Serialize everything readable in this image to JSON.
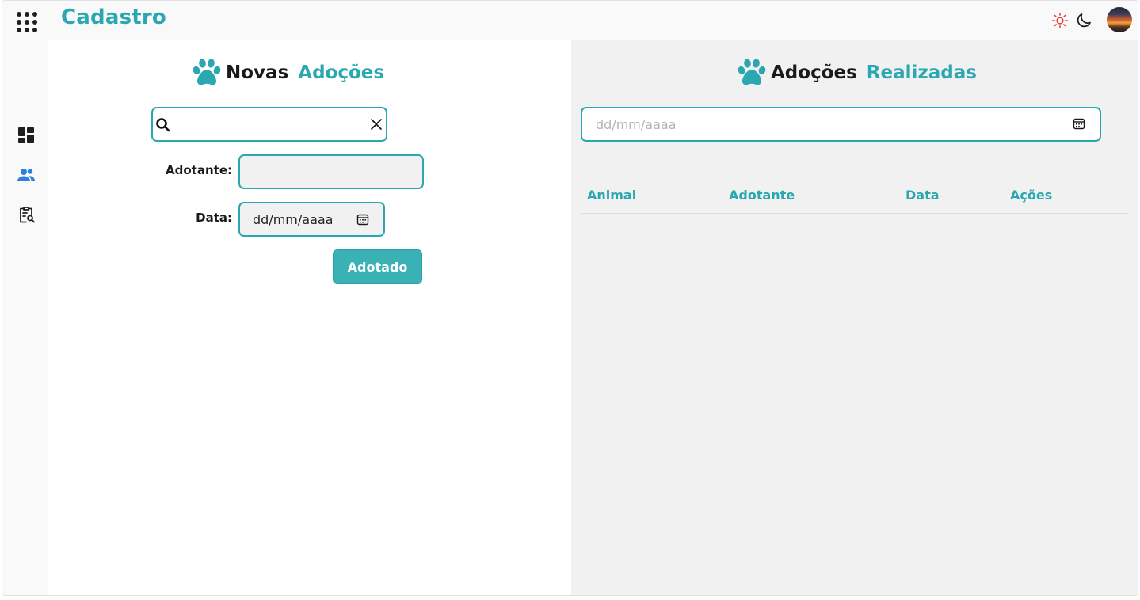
{
  "header": {
    "title": "Cadastro",
    "accent_color": "#2aa7b0",
    "icons": [
      "apps-grid-icon",
      "sun-icon",
      "moon-icon",
      "avatar"
    ]
  },
  "sidebar": {
    "items": [
      {
        "name": "dashboard",
        "icon": "dashboard-icon",
        "active": false
      },
      {
        "name": "users",
        "icon": "users-icon",
        "active": true
      },
      {
        "name": "clipboard-search",
        "icon": "clipboard-search-icon",
        "active": false
      }
    ]
  },
  "new_adoptions": {
    "title_part1": "Novas",
    "title_part2": "Adoções",
    "search": {
      "value": "",
      "placeholder": ""
    },
    "adotante_label": "Adotante:",
    "adotante_value": "",
    "data_label": "Data:",
    "date_placeholder": "dd/mm/aaaa",
    "submit_label": "Adotado"
  },
  "completed_adoptions": {
    "title_part1": "Adoções",
    "title_part2": "Realizadas",
    "date_placeholder": "dd/mm/aaaa",
    "columns": [
      "Animal",
      "Adotante",
      "Data",
      "Ações"
    ],
    "rows": []
  },
  "colors": {
    "teal": "#2aa7b0",
    "button": "#3ab1b5",
    "active_sidebar": "#2f7fe0",
    "sun": "#e53935"
  }
}
